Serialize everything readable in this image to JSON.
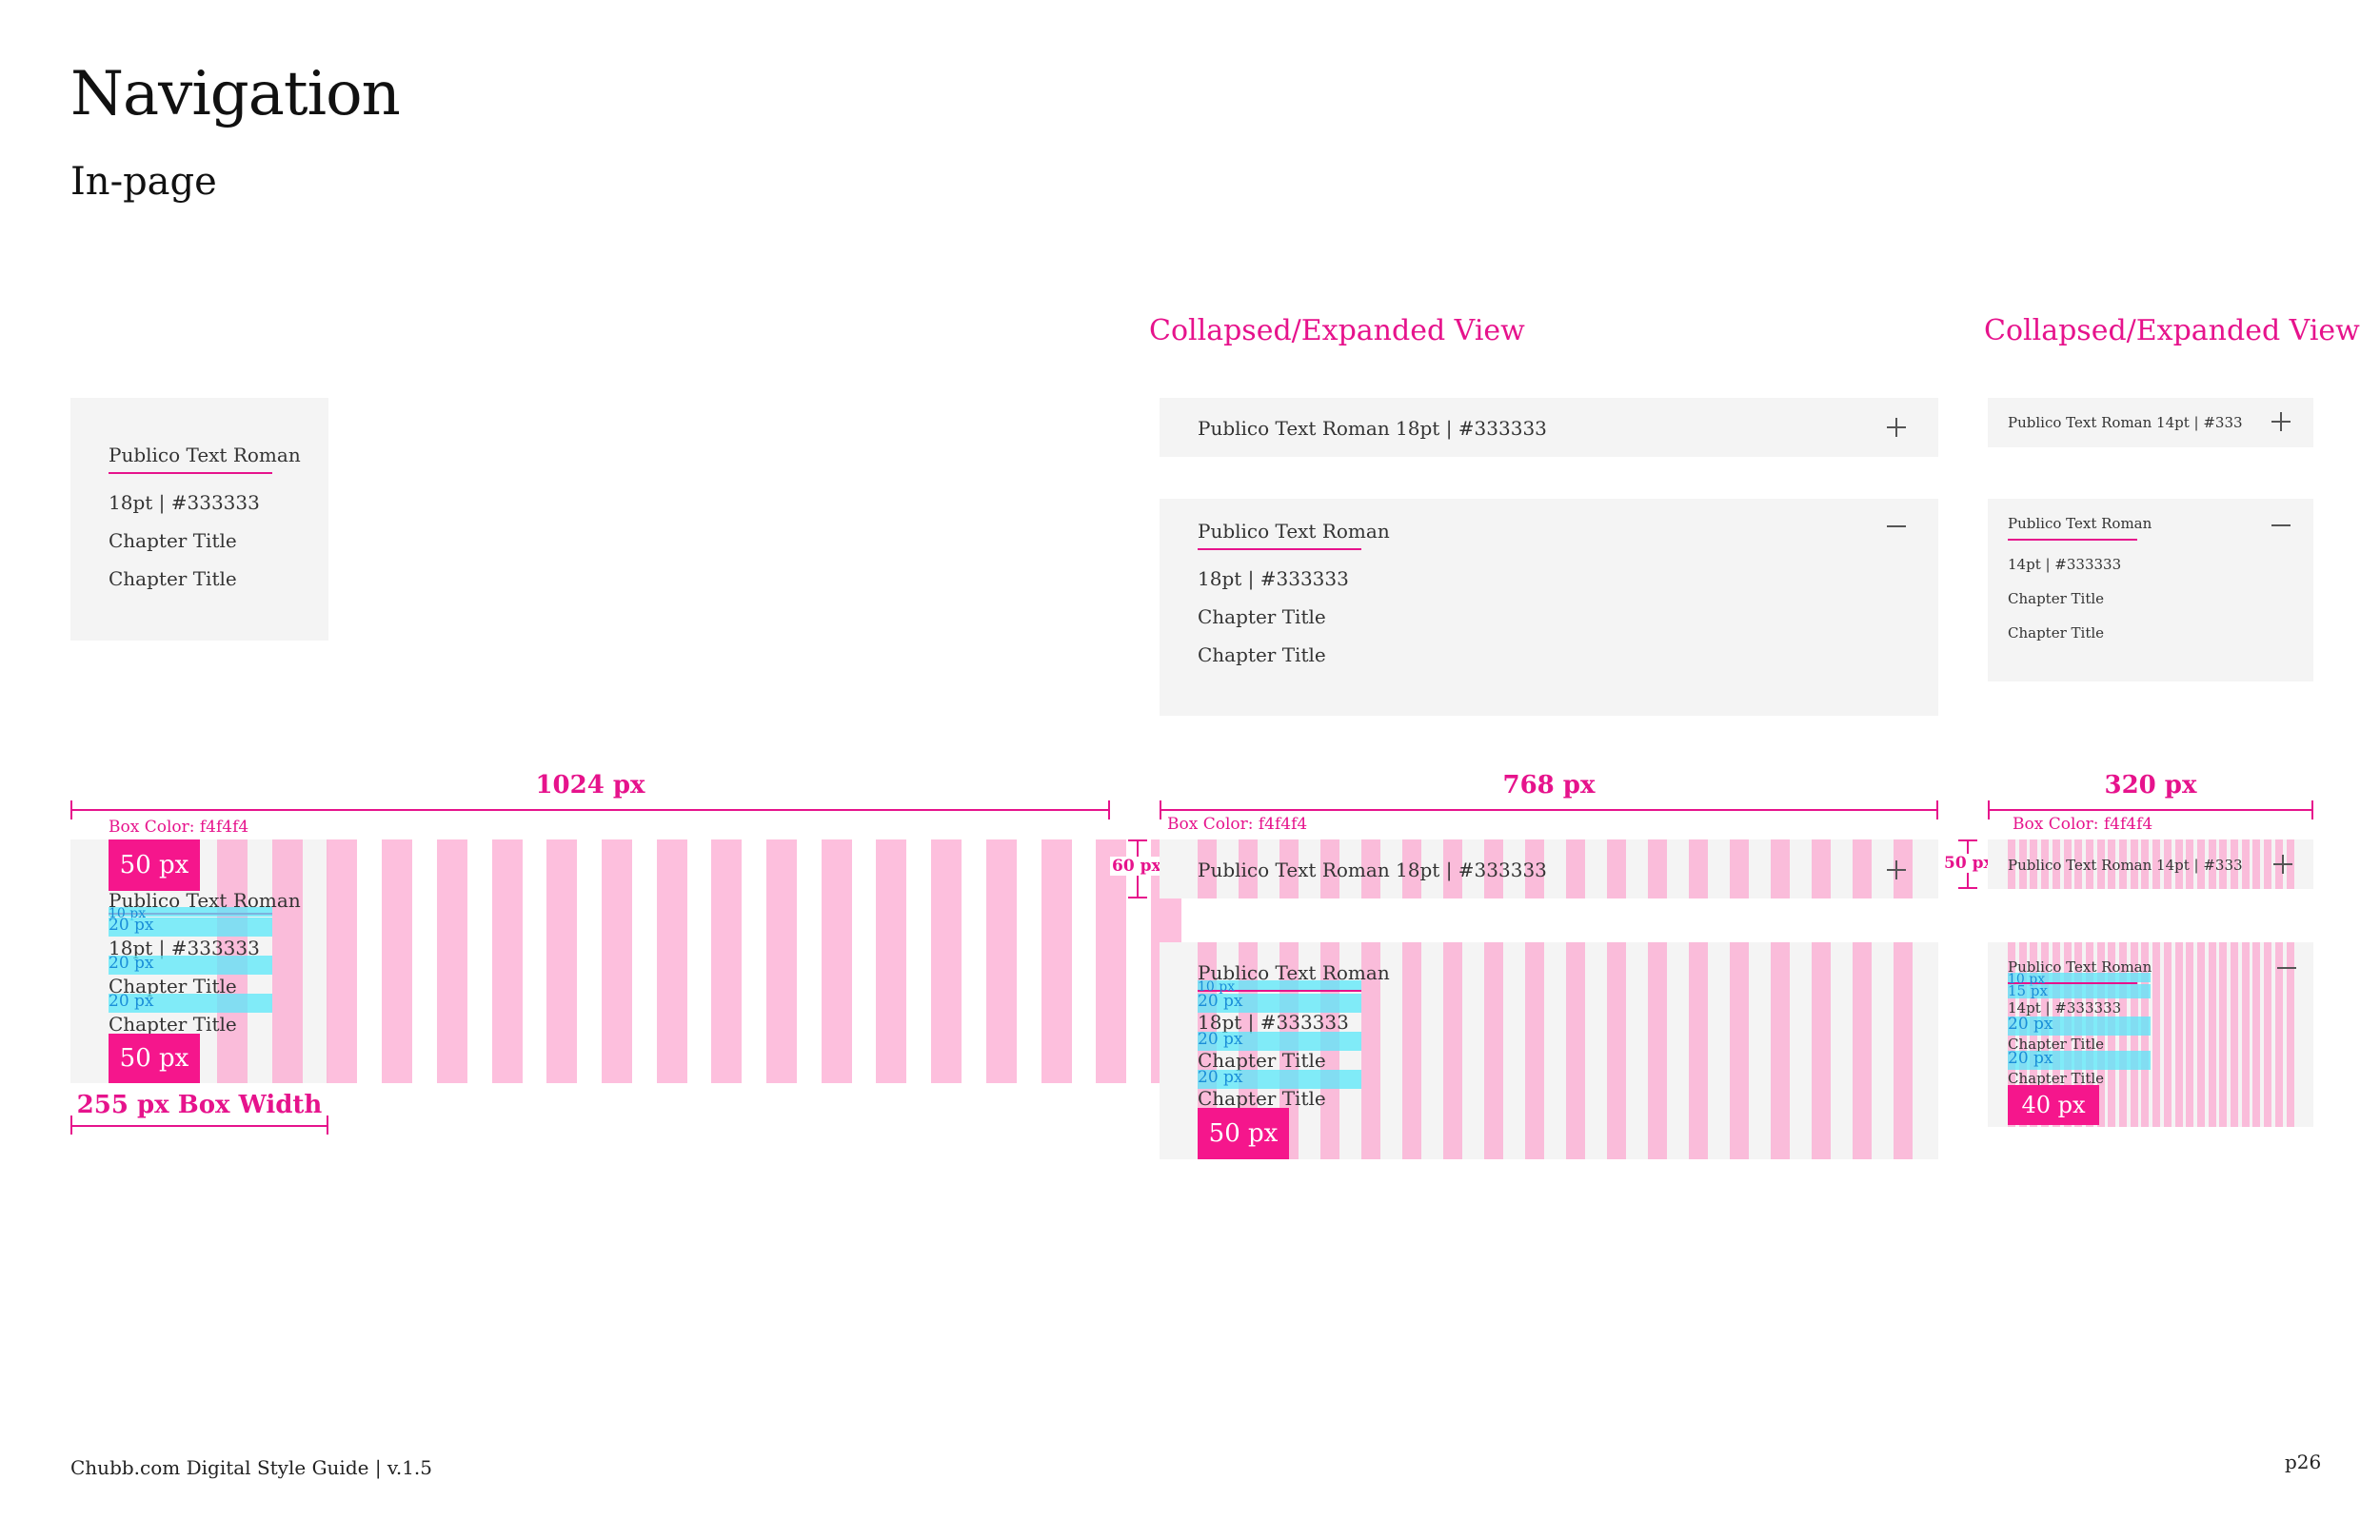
{
  "header": {
    "title": "Navigation",
    "subtitle": "In-page"
  },
  "sections": {
    "tablet_title": "Collapsed/Expanded View",
    "mobile_title": "Collapsed/Expanded View"
  },
  "desktop_sample": {
    "heading": "Publico Text Roman",
    "line1": "18pt | #333333",
    "line2": "Chapter Title",
    "line3": "Chapter Title"
  },
  "tablet_collapsed": {
    "label": "Publico Text Roman 18pt | #333333"
  },
  "tablet_expanded": {
    "heading": "Publico Text Roman",
    "line1": "18pt | #333333",
    "line2": "Chapter Title",
    "line3": "Chapter Title"
  },
  "mobile_collapsed": {
    "label": "Publico Text Roman 14pt | #333"
  },
  "mobile_expanded": {
    "heading": "Publico Text Roman",
    "line1": "14pt | #333333",
    "line2": "Chapter Title",
    "line3": "Chapter Title"
  },
  "specs": {
    "desktop_width": "1024 px",
    "tablet_width": "768 px",
    "mobile_width": "320 px",
    "box_color": "Box Color: f4f4f4",
    "box_width": "255 px Box Width",
    "pad_50": "50 px",
    "pad_40": "40 px",
    "height_60": "60 px",
    "height_50": "50 px",
    "gap_10": "10 px",
    "gap_15": "15 px",
    "gap_20": "20 px",
    "desktop_text": {
      "heading": "Publico Text Roman",
      "line1": "18pt | #333333",
      "line2": "Chapter Title",
      "line3": "Chapter Title"
    },
    "tablet_text": {
      "collapsed": "Publico Text Roman 18pt | #333333",
      "heading": "Publico Text Roman",
      "line1": "18pt | #333333",
      "line2": "Chapter Title",
      "line3": "Chapter Title"
    },
    "mobile_text": {
      "collapsed": "Publico Text Roman 14pt | #333",
      "heading": "Publico Text Roman",
      "line1": "14pt | #333333",
      "line2": "Chapter Title",
      "line3": "Chapter Title"
    }
  },
  "colors": {
    "accent": "#e6138c",
    "box": "#f4f4f4",
    "text": "#333333",
    "grid": "#fcaad2",
    "spacing": "#5ae8fa"
  },
  "icons": {
    "expand": "plus-icon",
    "collapse": "minus-icon"
  },
  "footer": {
    "guide": "Chubb.com Digital Style Guide | v.1.5",
    "page": "p26"
  }
}
